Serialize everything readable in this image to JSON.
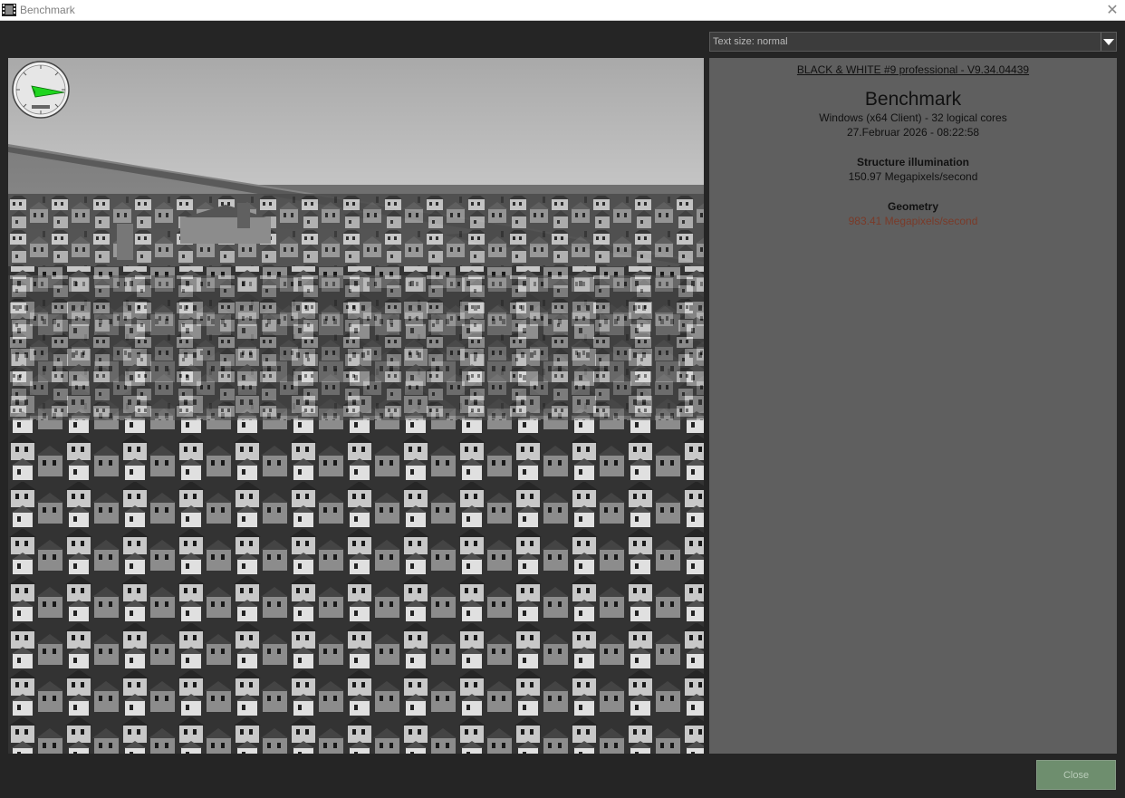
{
  "window": {
    "title": "Benchmark"
  },
  "text_size": {
    "label": "Text size: normal"
  },
  "info": {
    "version": "BLACK & WHITE #9 professional - V9.34.04439",
    "heading": "Benchmark",
    "system": "Windows (x64 Client) - 32 logical cores",
    "datetime": "27.Februar 2026 - 08:22:58",
    "results": [
      {
        "name": "Structure illumination",
        "value": "150.97 Megapixels/second",
        "highlight": false
      },
      {
        "name": "Geometry",
        "value": "983.41 Megapixels/second",
        "highlight": true
      }
    ]
  },
  "footer": {
    "close_label": "Close"
  },
  "colors": {
    "background": "#252525",
    "info_panel": "#5f5f5f",
    "highlight_value": "#7a3a28",
    "close_button": "#6e8e6e",
    "compass_needle": "#1fd51f"
  },
  "icons": {
    "app": "film-icon",
    "close": "close-icon",
    "dropdown": "chevron-down-icon",
    "gauge": "compass-gauge-icon"
  }
}
